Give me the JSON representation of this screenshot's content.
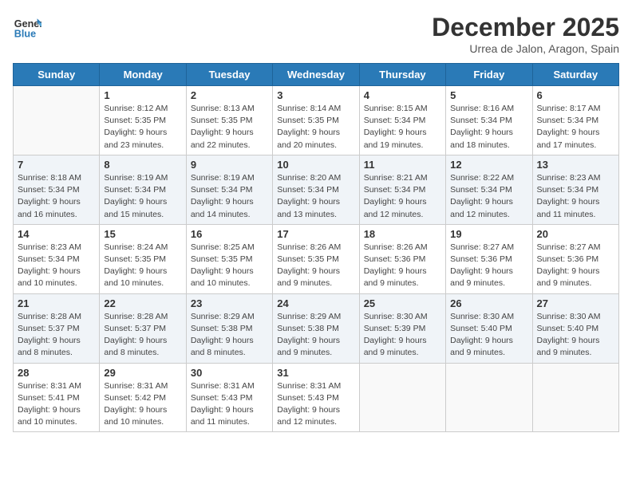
{
  "header": {
    "logo_line1": "General",
    "logo_line2": "Blue",
    "month_year": "December 2025",
    "location": "Urrea de Jalon, Aragon, Spain"
  },
  "weekdays": [
    "Sunday",
    "Monday",
    "Tuesday",
    "Wednesday",
    "Thursday",
    "Friday",
    "Saturday"
  ],
  "weeks": [
    [
      {
        "day": "",
        "info": ""
      },
      {
        "day": "1",
        "info": "Sunrise: 8:12 AM\nSunset: 5:35 PM\nDaylight: 9 hours\nand 23 minutes."
      },
      {
        "day": "2",
        "info": "Sunrise: 8:13 AM\nSunset: 5:35 PM\nDaylight: 9 hours\nand 22 minutes."
      },
      {
        "day": "3",
        "info": "Sunrise: 8:14 AM\nSunset: 5:35 PM\nDaylight: 9 hours\nand 20 minutes."
      },
      {
        "day": "4",
        "info": "Sunrise: 8:15 AM\nSunset: 5:34 PM\nDaylight: 9 hours\nand 19 minutes."
      },
      {
        "day": "5",
        "info": "Sunrise: 8:16 AM\nSunset: 5:34 PM\nDaylight: 9 hours\nand 18 minutes."
      },
      {
        "day": "6",
        "info": "Sunrise: 8:17 AM\nSunset: 5:34 PM\nDaylight: 9 hours\nand 17 minutes."
      }
    ],
    [
      {
        "day": "7",
        "info": "Sunrise: 8:18 AM\nSunset: 5:34 PM\nDaylight: 9 hours\nand 16 minutes."
      },
      {
        "day": "8",
        "info": "Sunrise: 8:19 AM\nSunset: 5:34 PM\nDaylight: 9 hours\nand 15 minutes."
      },
      {
        "day": "9",
        "info": "Sunrise: 8:19 AM\nSunset: 5:34 PM\nDaylight: 9 hours\nand 14 minutes."
      },
      {
        "day": "10",
        "info": "Sunrise: 8:20 AM\nSunset: 5:34 PM\nDaylight: 9 hours\nand 13 minutes."
      },
      {
        "day": "11",
        "info": "Sunrise: 8:21 AM\nSunset: 5:34 PM\nDaylight: 9 hours\nand 12 minutes."
      },
      {
        "day": "12",
        "info": "Sunrise: 8:22 AM\nSunset: 5:34 PM\nDaylight: 9 hours\nand 12 minutes."
      },
      {
        "day": "13",
        "info": "Sunrise: 8:23 AM\nSunset: 5:34 PM\nDaylight: 9 hours\nand 11 minutes."
      }
    ],
    [
      {
        "day": "14",
        "info": "Sunrise: 8:23 AM\nSunset: 5:34 PM\nDaylight: 9 hours\nand 10 minutes."
      },
      {
        "day": "15",
        "info": "Sunrise: 8:24 AM\nSunset: 5:35 PM\nDaylight: 9 hours\nand 10 minutes."
      },
      {
        "day": "16",
        "info": "Sunrise: 8:25 AM\nSunset: 5:35 PM\nDaylight: 9 hours\nand 10 minutes."
      },
      {
        "day": "17",
        "info": "Sunrise: 8:26 AM\nSunset: 5:35 PM\nDaylight: 9 hours\nand 9 minutes."
      },
      {
        "day": "18",
        "info": "Sunrise: 8:26 AM\nSunset: 5:36 PM\nDaylight: 9 hours\nand 9 minutes."
      },
      {
        "day": "19",
        "info": "Sunrise: 8:27 AM\nSunset: 5:36 PM\nDaylight: 9 hours\nand 9 minutes."
      },
      {
        "day": "20",
        "info": "Sunrise: 8:27 AM\nSunset: 5:36 PM\nDaylight: 9 hours\nand 9 minutes."
      }
    ],
    [
      {
        "day": "21",
        "info": "Sunrise: 8:28 AM\nSunset: 5:37 PM\nDaylight: 9 hours\nand 8 minutes."
      },
      {
        "day": "22",
        "info": "Sunrise: 8:28 AM\nSunset: 5:37 PM\nDaylight: 9 hours\nand 8 minutes."
      },
      {
        "day": "23",
        "info": "Sunrise: 8:29 AM\nSunset: 5:38 PM\nDaylight: 9 hours\nand 8 minutes."
      },
      {
        "day": "24",
        "info": "Sunrise: 8:29 AM\nSunset: 5:38 PM\nDaylight: 9 hours\nand 9 minutes."
      },
      {
        "day": "25",
        "info": "Sunrise: 8:30 AM\nSunset: 5:39 PM\nDaylight: 9 hours\nand 9 minutes."
      },
      {
        "day": "26",
        "info": "Sunrise: 8:30 AM\nSunset: 5:40 PM\nDaylight: 9 hours\nand 9 minutes."
      },
      {
        "day": "27",
        "info": "Sunrise: 8:30 AM\nSunset: 5:40 PM\nDaylight: 9 hours\nand 9 minutes."
      }
    ],
    [
      {
        "day": "28",
        "info": "Sunrise: 8:31 AM\nSunset: 5:41 PM\nDaylight: 9 hours\nand 10 minutes."
      },
      {
        "day": "29",
        "info": "Sunrise: 8:31 AM\nSunset: 5:42 PM\nDaylight: 9 hours\nand 10 minutes."
      },
      {
        "day": "30",
        "info": "Sunrise: 8:31 AM\nSunset: 5:43 PM\nDaylight: 9 hours\nand 11 minutes."
      },
      {
        "day": "31",
        "info": "Sunrise: 8:31 AM\nSunset: 5:43 PM\nDaylight: 9 hours\nand 12 minutes."
      },
      {
        "day": "",
        "info": ""
      },
      {
        "day": "",
        "info": ""
      },
      {
        "day": "",
        "info": ""
      }
    ]
  ]
}
